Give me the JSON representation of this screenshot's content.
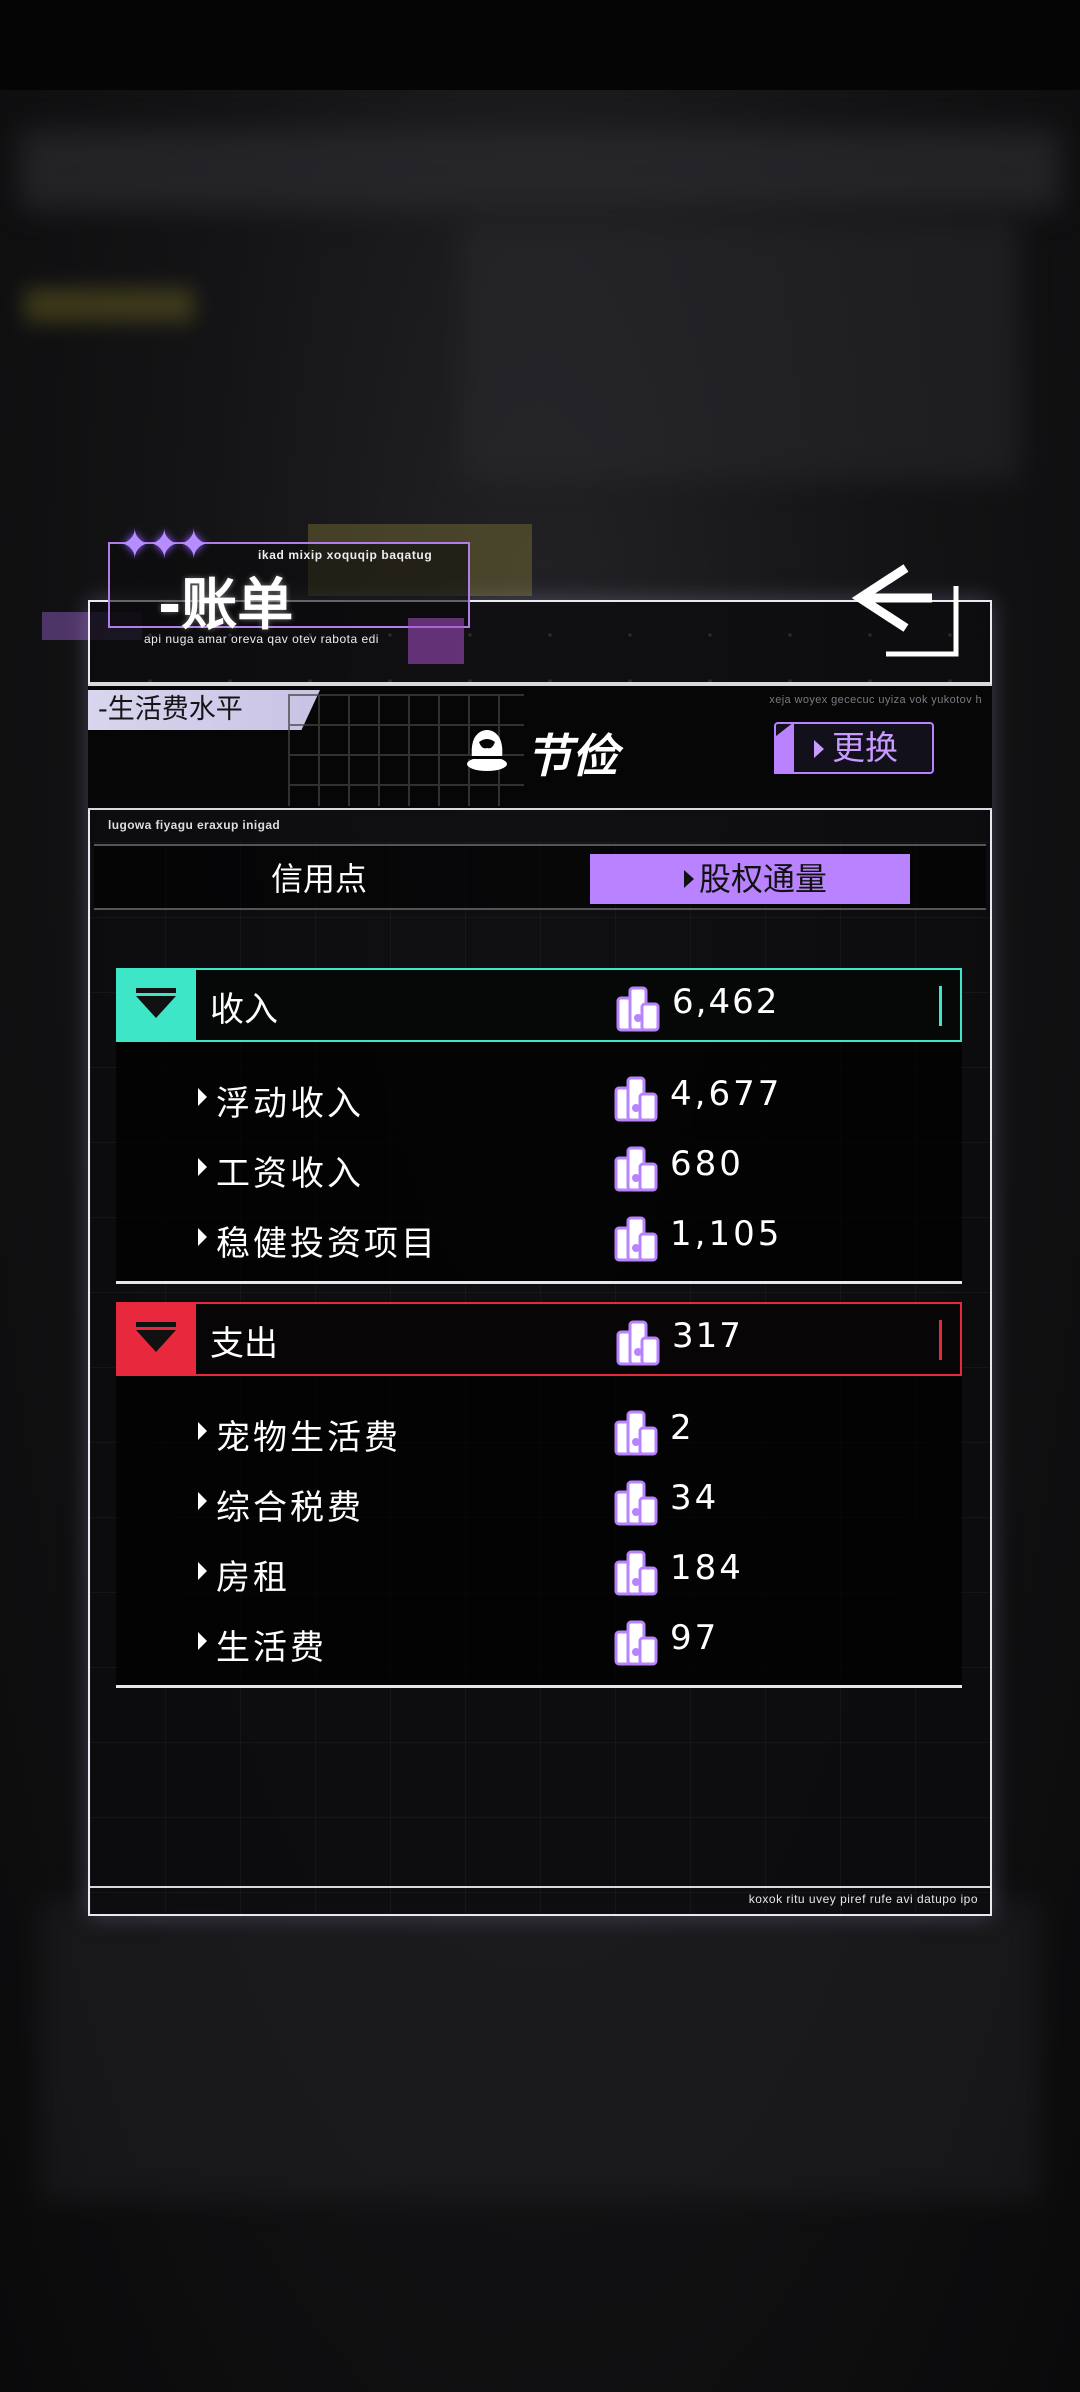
{
  "header": {
    "title": "-账单",
    "subtitle": "ikad mixip xoquqip baqatug",
    "description": "api nuga amar oreva qav otev rabota edi"
  },
  "level": {
    "label": "-生活费水平",
    "note": "xeja woyex gececuc uyiza vok yukotov h",
    "value": "节俭",
    "change_label": "更换"
  },
  "tabs": {
    "note": "lugowa fiyagu eraxup inigad",
    "items": [
      {
        "label": "信用点",
        "selected": false
      },
      {
        "label": "股权通量",
        "selected": true
      }
    ]
  },
  "income": {
    "label": "收入",
    "total": "6,462",
    "accent_color": "#3ee6c8",
    "items": [
      {
        "label": "浮动收入",
        "value": "4,677"
      },
      {
        "label": "工资收入",
        "value": "680"
      },
      {
        "label": "稳健投资项目",
        "value": "1,105"
      }
    ]
  },
  "expense": {
    "label": "支出",
    "total": "317",
    "accent_color": "#e8283c",
    "items": [
      {
        "label": "宠物生活费",
        "value": "2"
      },
      {
        "label": "综合税费",
        "value": "34"
      },
      {
        "label": "房租",
        "value": "184"
      },
      {
        "label": "生活费",
        "value": "97"
      }
    ]
  },
  "footer": {
    "text": "koxok ritu uvey piref rufe avi datupo ipo"
  },
  "icons": {
    "currency": "equity-flux-coin-icon",
    "back": "back-arrow-icon",
    "level": "saving-pot-icon"
  }
}
